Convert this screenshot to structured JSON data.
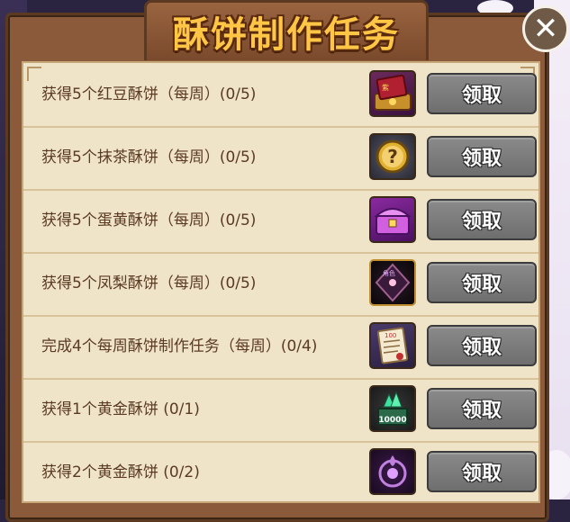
{
  "dialog": {
    "title": "酥饼制作任务",
    "close_glyph": "✕"
  },
  "tasks": [
    {
      "label": "获得5个红豆酥饼（每周）(0/5)",
      "button": "领取",
      "icon": "red-bean-cake-chest-icon",
      "tag": "紫"
    },
    {
      "label": "获得5个抹茶酥饼（每周）(0/5)",
      "button": "领取",
      "icon": "mystery-question-icon",
      "tag": "?"
    },
    {
      "label": "获得5个蛋黄酥饼（每周）(0/5)",
      "button": "领取",
      "icon": "purple-treasure-chest-icon",
      "tag": ""
    },
    {
      "label": "获得5个凤梨酥饼（每周）(0/5)",
      "button": "领取",
      "icon": "dark-crystal-gem-icon",
      "tag": "角色"
    },
    {
      "label": "完成4个每周酥饼制作任务（每周）(0/4)",
      "button": "领取",
      "icon": "scroll-document-icon",
      "tag": "100"
    },
    {
      "label": "获得1个黄金酥饼 (0/1)",
      "button": "领取",
      "icon": "gem-gift-box-icon",
      "tag": "10000"
    },
    {
      "label": "获得2个黄金酥饼 (0/2)",
      "button": "领取",
      "icon": "purple-emblem-icon",
      "tag": ""
    }
  ]
}
